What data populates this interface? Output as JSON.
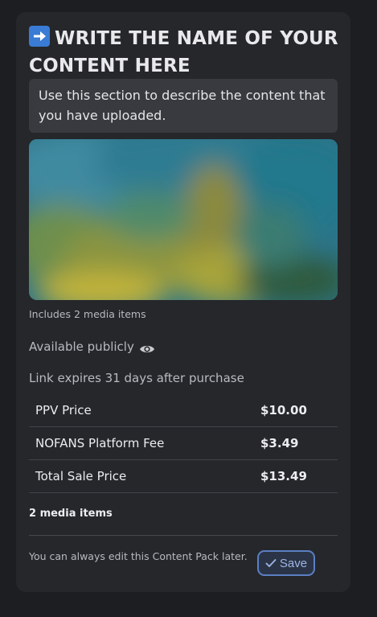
{
  "content_pack": {
    "title": "WRITE THE NAME OF YOUR CONTENT HERE",
    "title_icon": "right-arrow-emoji-icon",
    "description": "Use this section to describe the content that you have uploaded.",
    "includes_text": "Includes 2 media items",
    "visibility_text": "Available publicly",
    "visibility_icon": "eye-icon",
    "expiry_text": "Link expires 31 days after purchase",
    "pricing": [
      {
        "label": "PPV Price",
        "value": "$10.00"
      },
      {
        "label": "NOFANS Platform Fee",
        "value": "$3.49"
      },
      {
        "label": "Total Sale Price",
        "value": "$13.49"
      }
    ],
    "media_count_text": "2 media items",
    "footer_note": "You can always edit this Content Pack later.",
    "save_label": "Save",
    "save_icon": "checkmark-icon"
  },
  "colors": {
    "background": "#1c1e22",
    "card": "#25272b",
    "accent": "#5b7fc4",
    "title_icon_bg": "#3a7bd5"
  }
}
